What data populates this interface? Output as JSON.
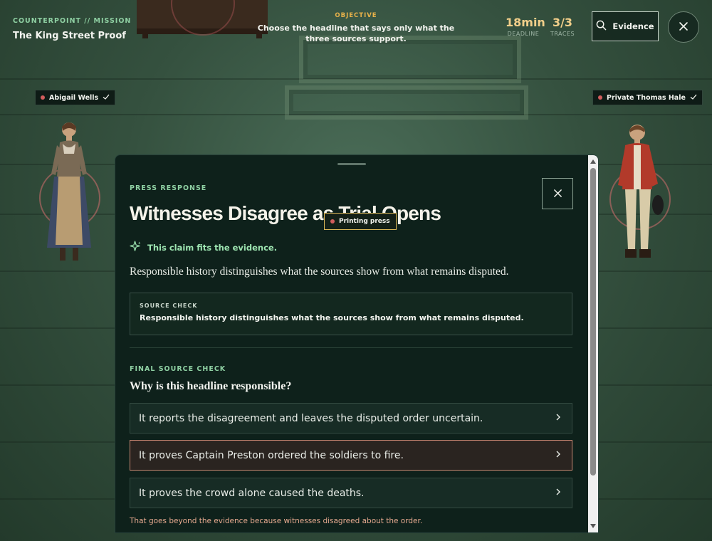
{
  "header": {
    "mission_kicker": "COUNTERPOINT // MISSION",
    "mission_title": "The King Street Proof",
    "objective_kicker": "OBJECTIVE",
    "objective_text": "Choose the headline that says only what the three sources support.",
    "deadline_value": "18min",
    "deadline_label": "DEADLINE",
    "traces_value": "3/3",
    "traces_label": "TRACES",
    "evidence_label": "Evidence"
  },
  "witnesses": [
    {
      "name": "Abigail Wells",
      "verified": true
    },
    {
      "name": "Private Thomas Hale",
      "verified": true
    }
  ],
  "press_tag": "Printing press",
  "modal": {
    "kicker": "PRESS RESPONSE",
    "headline": "Witnesses Disagree as Trial Opens",
    "fit_status": "This claim fits the evidence.",
    "lead": "Responsible history distinguishes what the sources show from what remains disputed.",
    "source_check_label": "SOURCE CHECK",
    "source_check_text": "Responsible history distinguishes what the sources show from what remains disputed.",
    "final_kicker": "FINAL SOURCE CHECK",
    "question": "Why is this headline responsible?",
    "options": [
      {
        "label": "It reports the disagreement and leaves the disputed order uncertain."
      },
      {
        "label": "It proves Captain Preston ordered the soldiers to fire."
      },
      {
        "label": "It proves the crowd alone caused the deaths."
      }
    ],
    "feedback": "That goes beyond the evidence because witnesses disagreed about the order."
  },
  "colors": {
    "accent_green": "#8fd0a3",
    "objective_gold": "#e8b24a",
    "stat_gold": "#f2cf8a",
    "wrong_border": "#c98772",
    "feedback_text": "#e6a98f",
    "panel_bg": "#0e211b"
  }
}
